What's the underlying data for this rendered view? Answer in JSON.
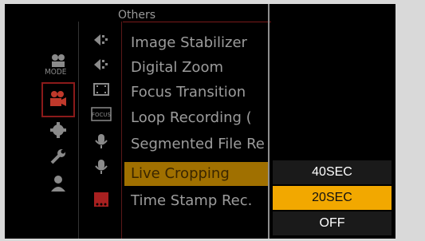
{
  "category_header": "Others",
  "left_tab": {
    "mode_label": "MODE"
  },
  "menu_items": [
    {
      "label": "Image Stabilizer",
      "icon": "stabilizer-icon"
    },
    {
      "label": "Digital Zoom",
      "icon": "zoom-icon"
    },
    {
      "label": "Focus Transition",
      "icon": "film-icon"
    },
    {
      "label": "Loop Recording (",
      "icon": "focus-icon"
    },
    {
      "label": "Segmented File Re",
      "icon": "mic-icon"
    },
    {
      "label": "Live Cropping",
      "icon": "mic-icon",
      "selected": true
    },
    {
      "label": "Time Stamp Rec.",
      "icon": "rec-icon"
    }
  ],
  "focus_label": "FOCUS",
  "options": [
    {
      "label": "40SEC",
      "selected": false
    },
    {
      "label": "20SEC",
      "selected": true
    },
    {
      "label": "OFF",
      "selected": false
    }
  ],
  "colors": {
    "selected_option": "#f2a800",
    "selected_item": "#a07000",
    "background": "#000000",
    "frame": "#d9d9d9"
  }
}
